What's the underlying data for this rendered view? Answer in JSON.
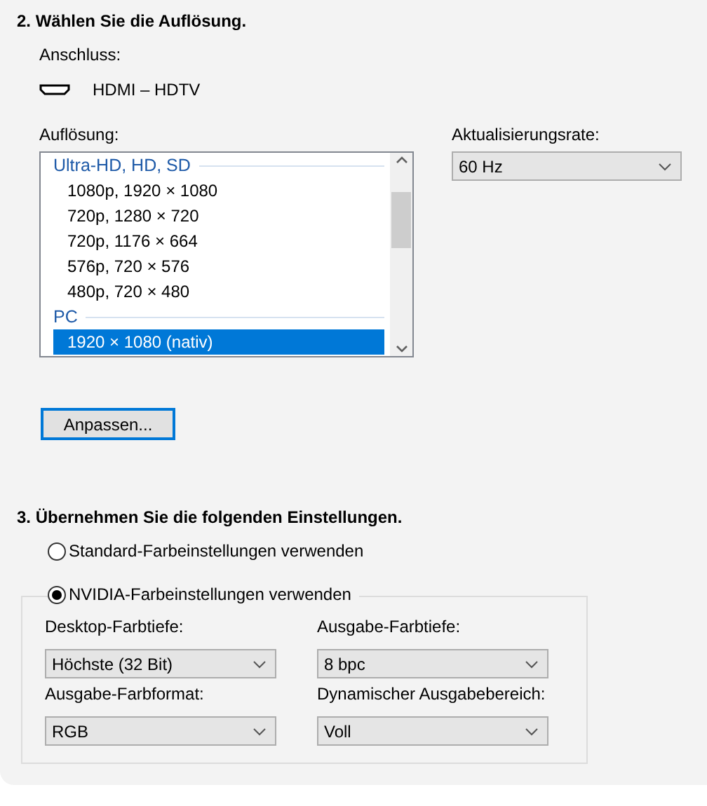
{
  "section_2": {
    "title": "2. Wählen Sie die Auflösung.",
    "connector_label": "Anschluss:",
    "connector": "HDMI – HDTV",
    "resolution_label": "Auflösung:",
    "resolution_list": [
      {
        "kind": "group",
        "label": "Ultra-HD, HD, SD"
      },
      {
        "kind": "item",
        "label": "1080p, 1920 × 1080",
        "selected": false
      },
      {
        "kind": "item",
        "label": "720p, 1280 × 720",
        "selected": false
      },
      {
        "kind": "item",
        "label": "720p, 1176 × 664",
        "selected": false
      },
      {
        "kind": "item",
        "label": "576p, 720 × 576",
        "selected": false
      },
      {
        "kind": "item",
        "label": "480p, 720 × 480",
        "selected": false
      },
      {
        "kind": "group",
        "label": "PC"
      },
      {
        "kind": "item",
        "label": "1920 × 1080 (nativ)",
        "selected": true
      }
    ],
    "refresh_label": "Aktualisierungsrate:",
    "refresh_value": "60 Hz",
    "customize_button": "Anpassen..."
  },
  "section_3": {
    "title": "3. Übernehmen Sie die folgenden Einstellungen.",
    "options": [
      {
        "label": "Standard-Farbeinstellungen verwenden",
        "selected": false
      },
      {
        "label": "NVIDIA-Farbeinstellungen verwenden",
        "selected": true
      }
    ],
    "fields": [
      {
        "label": "Desktop-Farbtiefe:",
        "value": "Höchste (32 Bit)"
      },
      {
        "label": "Ausgabe-Farbtiefe:",
        "value": "8 bpc"
      },
      {
        "label": "Ausgabe-Farbformat:",
        "value": "RGB"
      },
      {
        "label": "Dynamischer Ausgabebereich:",
        "value": "Voll"
      }
    ]
  }
}
